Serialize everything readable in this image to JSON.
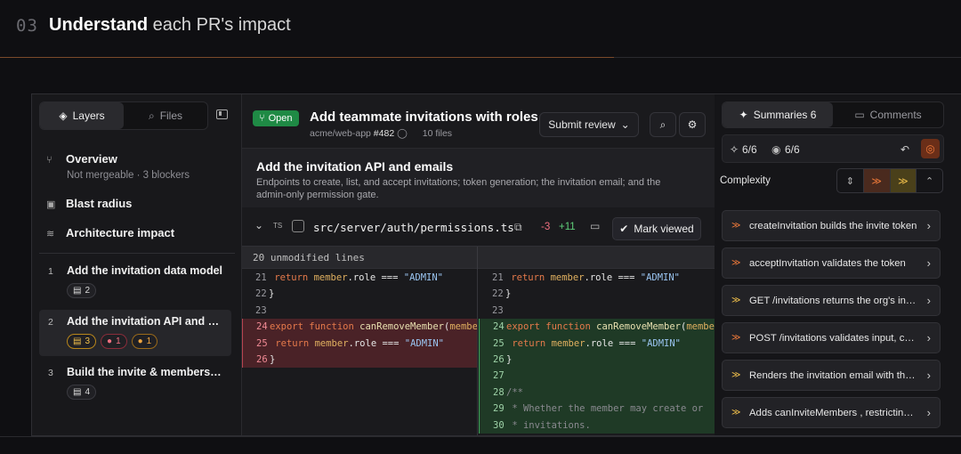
{
  "header": {
    "number": "03",
    "title_bold": "Understand",
    "title_rest": " each PR's impact"
  },
  "left": {
    "tabs": [
      {
        "label": "Layers",
        "icon": "layers-icon"
      },
      {
        "label": "Files",
        "icon": "search-icon"
      }
    ],
    "nav": [
      {
        "label": "Overview",
        "sub": "Not mergeable · 3 blockers",
        "icon": "branch-icon"
      },
      {
        "label": "Blast radius",
        "icon": "radius-icon"
      },
      {
        "label": "Architecture impact",
        "icon": "database-icon"
      }
    ],
    "steps": [
      {
        "num": "1",
        "title": "Add the invitation data model",
        "chips": [
          "2"
        ]
      },
      {
        "num": "2",
        "title": "Add the invitation API and emails",
        "chips": [
          "3",
          "1",
          "1"
        ]
      },
      {
        "num": "3",
        "title": "Build the invite & members UI",
        "chips": [
          "4"
        ]
      }
    ]
  },
  "pr": {
    "status": "Open",
    "title": "Add teammate invitations with roles",
    "repo": "acme/web-app",
    "number": "#482",
    "files": "10 files",
    "submit_label": "Submit review"
  },
  "section": {
    "title": "Add the invitation API and emails",
    "desc": "Endpoints to create, list, and accept invitations; token generation; the invitation email; and the admin-only permission gate."
  },
  "file": {
    "path": "src/server/auth/permissions.ts",
    "lang": "TS",
    "removed": "-3",
    "added": "+11",
    "mark_label": "Mark viewed",
    "unmodified": "20 unmodified lines"
  },
  "right": {
    "tabs": [
      {
        "label": "Summaries 6"
      },
      {
        "label": "Comments"
      }
    ],
    "progress_a": "6/6",
    "progress_b": "6/6",
    "complexity_label": "Complexity",
    "items": [
      {
        "text": "createInvitation builds the invite token",
        "level": "high"
      },
      {
        "text": "acceptInvitation validates the token",
        "level": "high"
      },
      {
        "text": "GET /invitations returns the org's invitations",
        "level": "low"
      },
      {
        "text": "POST /invitations validates input, checks permission",
        "level": "high"
      },
      {
        "text": "Renders the invitation email with the link",
        "level": "low"
      },
      {
        "text": "Adds canInviteMembers , restricting to admins",
        "level": "low"
      }
    ]
  },
  "colors": {
    "accent": "#f07a3a",
    "add": "#1f3a26",
    "del": "#4a2227",
    "open": "#1f8a45"
  }
}
